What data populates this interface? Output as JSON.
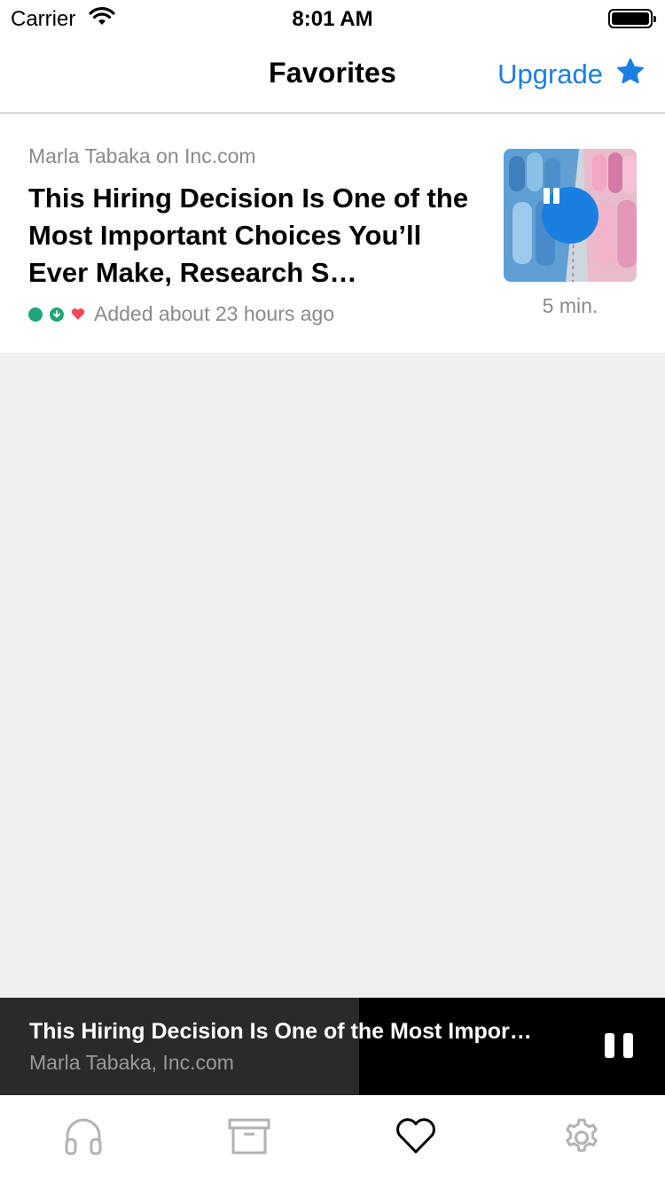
{
  "status_bar": {
    "carrier": "Carrier",
    "time": "8:01 AM"
  },
  "nav": {
    "title": "Favorites",
    "upgrade_label": "Upgrade",
    "upgrade_icon": "star-icon"
  },
  "article": {
    "source": "Marla Tabaka on Inc.com",
    "title": "This Hiring Decision Is One of the Most Important Choices You’ll Ever Make, Research S…",
    "added": "Added about 23 hours ago",
    "duration": "5 min.",
    "status_icons": [
      "unread-dot-icon",
      "downloaded-icon",
      "favorite-heart-icon"
    ]
  },
  "player": {
    "title": "This Hiring Decision Is One of the Most Impor…",
    "subtitle": "Marla Tabaka, Inc.com",
    "progress_fraction": 0.54
  },
  "tabs": [
    {
      "name": "listen",
      "icon": "headphones-icon",
      "active": false
    },
    {
      "name": "archive",
      "icon": "archive-box-icon",
      "active": false
    },
    {
      "name": "favorites",
      "icon": "heart-icon",
      "active": true
    },
    {
      "name": "settings",
      "icon": "gear-icon",
      "active": false
    }
  ],
  "colors": {
    "accent": "#1a7fe0",
    "green": "#1fa67a",
    "heart": "#ef4a5a",
    "gray_text": "#8a8a8a",
    "background": "#efefef"
  }
}
